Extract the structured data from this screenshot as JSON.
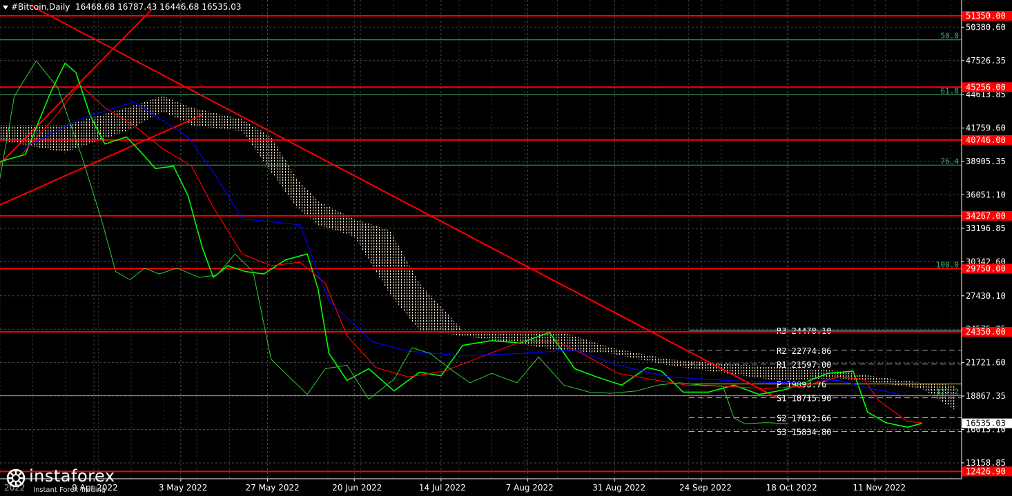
{
  "header": {
    "symbol": "#Bitcoin,Daily",
    "ohlc": "16468.68 16787.43 16446.68 16535.03"
  },
  "logo": {
    "name": "instaforex",
    "tagline": "Instant Forex Trading",
    "overlay_text": "2022"
  },
  "colors": {
    "background": "#000000",
    "grid": "#4a4a4a",
    "axis": "#ffffff",
    "price_line": "#00ff00",
    "chikou": "#32cd32",
    "tenkan": "#ff0000",
    "kijun": "#0000ff",
    "cloud": "#ffe4c4",
    "level": "#ff0000",
    "fibo": "#3cb371",
    "pivot": "#ffffff"
  },
  "chart_data": {
    "type": "line",
    "title": "#Bitcoin,Daily",
    "ylim": [
      11800,
      52700
    ],
    "x_dates": [
      "9 Apr 2022",
      "3 May 2022",
      "27 May 2022",
      "20 Jun 2022",
      "14 Jul 2022",
      "7 Aug 2022",
      "31 Aug 2022",
      "24 Sep 2022",
      "18 Oct 2022",
      "11 Nov 2022"
    ],
    "y_ticks": [
      50380.6,
      47526.35,
      44613.85,
      41759.6,
      38905.35,
      36051.1,
      33196.85,
      30342.6,
      27430.1,
      24575.85,
      21721.6,
      18867.35,
      16013.1,
      13158.85
    ],
    "current_price": "16535.03",
    "horizontal_levels": [
      {
        "label": "51350.00",
        "value": 51350
      },
      {
        "label": "45256.00",
        "value": 45256
      },
      {
        "label": "40746.00",
        "value": 40746
      },
      {
        "label": "34267.00",
        "value": 34267
      },
      {
        "label": "29750.00",
        "value": 29750
      },
      {
        "label": "24350.00",
        "value": 24350
      },
      {
        "label": "12426.90",
        "value": 12426.9
      }
    ],
    "fibo_levels": [
      {
        "label": "50.0",
        "value": 49300
      },
      {
        "label": "61.8",
        "value": 44600
      },
      {
        "label": "76.4",
        "value": 38600
      },
      {
        "label": "100.0",
        "value": 29750
      },
      {
        "label": "127.2",
        "value": 18900
      }
    ],
    "pivot_levels": [
      {
        "name": "R3",
        "label": "24478.10",
        "value": 24478.1
      },
      {
        "name": "R2",
        "label": "22774.86",
        "value": 22774.86
      },
      {
        "name": "R1",
        "label": "21597.00",
        "value": 21597.0
      },
      {
        "name": "P",
        "label": "19893.76",
        "value": 19893.76
      },
      {
        "name": "S1",
        "label": "18715.90",
        "value": 18715.9
      },
      {
        "name": "S2",
        "label": "17012.66",
        "value": 17012.66
      },
      {
        "name": "S3",
        "label": "15834.80",
        "value": 15834.8
      }
    ],
    "series": [
      {
        "key": "price",
        "x": [
          "2022-03-14",
          "2022-03-21",
          "2022-03-28",
          "2022-04-01",
          "2022-04-04",
          "2022-04-08",
          "2022-04-12",
          "2022-04-18",
          "2022-04-22",
          "2022-04-26",
          "2022-05-01",
          "2022-05-05",
          "2022-05-09",
          "2022-05-12",
          "2022-05-16",
          "2022-05-21",
          "2022-05-26",
          "2022-06-01",
          "2022-06-07",
          "2022-06-10",
          "2022-06-13",
          "2022-06-18",
          "2022-06-24",
          "2022-07-01",
          "2022-07-08",
          "2022-07-14",
          "2022-07-20",
          "2022-07-28",
          "2022-08-05",
          "2022-08-13",
          "2022-08-20",
          "2022-08-26",
          "2022-09-02",
          "2022-09-09",
          "2022-09-13",
          "2022-09-19",
          "2022-09-26",
          "2022-10-03",
          "2022-10-10",
          "2022-10-17",
          "2022-10-24",
          "2022-10-29",
          "2022-11-05",
          "2022-11-09",
          "2022-11-14",
          "2022-11-20",
          "2022-11-24"
        ],
        "y": [
          38900,
          39500,
          44800,
          47300,
          46500,
          42800,
          40400,
          41000,
          39700,
          38300,
          38500,
          36000,
          31500,
          29000,
          30000,
          29500,
          29300,
          30500,
          31000,
          28000,
          22500,
          20200,
          21200,
          19300,
          20900,
          20600,
          23200,
          23600,
          23400,
          24300,
          21200,
          20500,
          19800,
          21300,
          21000,
          19200,
          19200,
          19800,
          19000,
          19400,
          20200,
          20800,
          21000,
          17500,
          16600,
          16200,
          16535
        ]
      },
      {
        "key": "tenkan",
        "x": [
          "2022-03-20",
          "2022-03-30",
          "2022-04-05",
          "2022-04-12",
          "2022-04-20",
          "2022-04-28",
          "2022-05-06",
          "2022-05-12",
          "2022-05-20",
          "2022-05-28",
          "2022-06-05",
          "2022-06-12",
          "2022-06-18",
          "2022-06-26",
          "2022-07-05",
          "2022-07-15",
          "2022-07-25",
          "2022-08-05",
          "2022-08-15",
          "2022-08-22",
          "2022-09-01",
          "2022-09-10",
          "2022-09-20",
          "2022-10-01",
          "2022-10-12",
          "2022-10-22",
          "2022-11-01",
          "2022-11-08",
          "2022-11-12",
          "2022-11-20",
          "2022-11-24"
        ],
        "y": [
          39500,
          43000,
          45500,
          43500,
          42000,
          40000,
          38500,
          35000,
          31000,
          30000,
          30300,
          28500,
          24000,
          21300,
          20500,
          21000,
          22200,
          23500,
          23500,
          22500,
          20800,
          20300,
          19800,
          19700,
          19500,
          19700,
          20500,
          20300,
          18500,
          16700,
          16600
        ]
      },
      {
        "key": "kijun",
        "x": [
          "2022-03-20",
          "2022-04-05",
          "2022-04-20",
          "2022-05-05",
          "2022-05-12",
          "2022-05-20",
          "2022-06-05",
          "2022-06-13",
          "2022-06-25",
          "2022-07-05",
          "2022-07-20",
          "2022-08-05",
          "2022-08-20",
          "2022-09-01",
          "2022-09-15",
          "2022-10-01",
          "2022-10-15",
          "2022-11-01",
          "2022-11-10",
          "2022-11-18"
        ],
        "y": [
          40000,
          42500,
          44000,
          41000,
          38000,
          34000,
          33500,
          27000,
          23500,
          22700,
          22300,
          22500,
          22800,
          21500,
          20500,
          20200,
          20000,
          20200,
          19500,
          19000
        ]
      },
      {
        "key": "chikou",
        "x": [
          "2022-03-14",
          "2022-03-18",
          "2022-03-24",
          "2022-03-30",
          "2022-04-06",
          "2022-04-11",
          "2022-04-15",
          "2022-04-19",
          "2022-04-23",
          "2022-04-27",
          "2022-05-02",
          "2022-05-08",
          "2022-05-13",
          "2022-05-18",
          "2022-05-23",
          "2022-05-28",
          "2022-06-02",
          "2022-06-07",
          "2022-06-12",
          "2022-06-18",
          "2022-06-24",
          "2022-07-01",
          "2022-07-06",
          "2022-07-11",
          "2022-07-16",
          "2022-07-22",
          "2022-07-28",
          "2022-08-04",
          "2022-08-10",
          "2022-08-17",
          "2022-08-24",
          "2022-08-30",
          "2022-09-06",
          "2022-09-12",
          "2022-09-18",
          "2022-09-24",
          "2022-09-30",
          "2022-10-03",
          "2022-10-06",
          "2022-10-12",
          "2022-10-18"
        ],
        "y": [
          37500,
          44500,
          47500,
          45200,
          39000,
          34000,
          29500,
          28800,
          29800,
          29300,
          29800,
          29000,
          29200,
          31000,
          29500,
          22000,
          20500,
          19000,
          21200,
          21500,
          18600,
          20300,
          23000,
          22500,
          21300,
          20000,
          20800,
          20000,
          22200,
          19800,
          19200,
          19100,
          19300,
          19800,
          20000,
          19800,
          19700,
          17000,
          16500,
          16600,
          16500
        ]
      }
    ],
    "cloud": {
      "x": [
        "2022-03-14",
        "2022-04-01",
        "2022-04-18",
        "2022-04-28",
        "2022-05-06",
        "2022-05-20",
        "2022-05-28",
        "2022-06-04",
        "2022-06-10",
        "2022-06-20",
        "2022-06-30",
        "2022-07-08",
        "2022-07-20",
        "2022-08-01",
        "2022-08-15",
        "2022-08-30",
        "2022-09-15",
        "2022-10-01",
        "2022-10-15",
        "2022-11-01",
        "2022-11-12",
        "2022-11-24",
        "2022-12-03"
      ],
      "span_a": [
        42000,
        42000,
        43500,
        44500,
        43500,
        42500,
        41000,
        37500,
        35500,
        34000,
        33000,
        28500,
        24500,
        24300,
        24500,
        23000,
        22000,
        21600,
        21400,
        21000,
        20500,
        20000,
        19800
      ],
      "span_b": [
        40700,
        39700,
        41500,
        43200,
        42000,
        41500,
        38000,
        35000,
        33500,
        32500,
        27500,
        24500,
        24000,
        23500,
        22800,
        22500,
        21500,
        20800,
        20200,
        20400,
        20000,
        19500,
        17700
      ]
    },
    "trendlines": [
      {
        "x1": "2022-03-14",
        "y1": 38700,
        "x2": "2022-04-25",
        "y2": 51900
      },
      {
        "x1": "2022-03-14",
        "y1": 35200,
        "x2": "2022-05-09",
        "y2": 42900
      },
      {
        "x1": "2022-03-22",
        "y1": 52300,
        "x2": "2022-10-15",
        "y2": 18700
      }
    ]
  }
}
